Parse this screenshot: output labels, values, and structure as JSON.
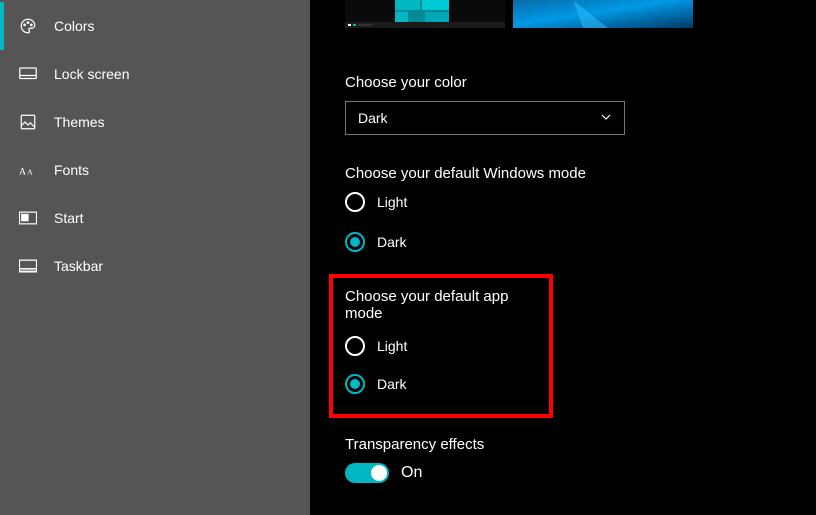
{
  "sidebar": {
    "items": [
      {
        "label": "Colors"
      },
      {
        "label": "Lock screen"
      },
      {
        "label": "Themes"
      },
      {
        "label": "Fonts"
      },
      {
        "label": "Start"
      },
      {
        "label": "Taskbar"
      }
    ]
  },
  "colorSection": {
    "heading": "Choose your color",
    "dropdownValue": "Dark"
  },
  "windowsMode": {
    "heading": "Choose your default Windows mode",
    "optionLight": "Light",
    "optionDark": "Dark"
  },
  "appMode": {
    "heading": "Choose your default app mode",
    "optionLight": "Light",
    "optionDark": "Dark"
  },
  "transparency": {
    "heading": "Transparency effects",
    "state": "On"
  },
  "accentColor": "#00b7c3"
}
